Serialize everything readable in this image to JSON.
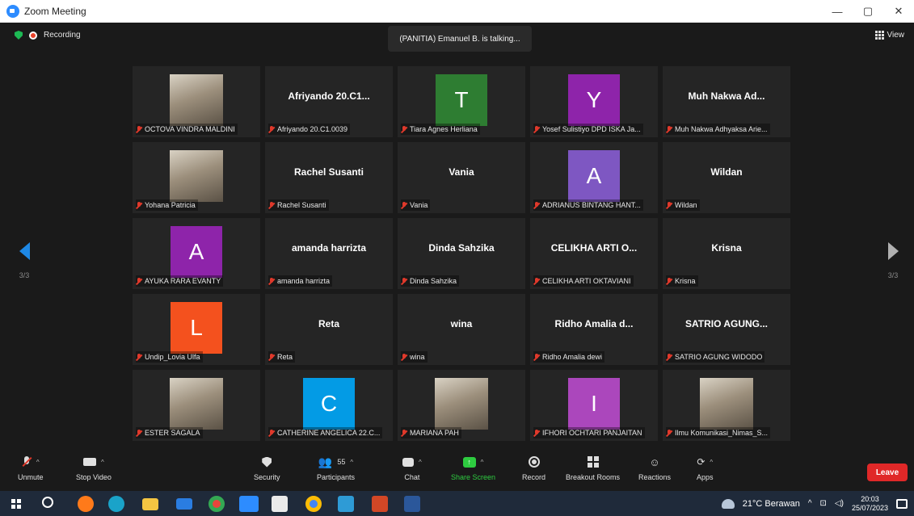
{
  "window": {
    "title": "Zoom Meeting",
    "min": "—",
    "max": "▢",
    "close": "✕"
  },
  "topbar": {
    "recording": "Recording",
    "talking": "(PANITIA) Emanuel B. is talking...",
    "view": "View"
  },
  "pager": {
    "left": "3/3",
    "right": "3/3"
  },
  "tiles": [
    {
      "big": "",
      "avatar": "",
      "photo": true,
      "label": "OCTOVA VINDRA MALDINI"
    },
    {
      "big": "Afriyando 20.C1...",
      "avatar": "",
      "label": "Afriyando 20.C1.0039"
    },
    {
      "big": "",
      "avatar": "T",
      "color": "#2e7d32",
      "label": "Tiara Agnes Herliana"
    },
    {
      "big": "",
      "avatar": "Y",
      "color": "#8e24aa",
      "label": "Yosef Sulistiyo DPD ISKA Ja..."
    },
    {
      "big": "Muh Nakwa Ad...",
      "avatar": "",
      "label": "Muh Nakwa Adhyaksa Arie..."
    },
    {
      "big": "",
      "avatar": "",
      "photo": true,
      "label": "Yohana Patricia"
    },
    {
      "big": "Rachel Susanti",
      "avatar": "",
      "label": "Rachel Susanti"
    },
    {
      "big": "Vania",
      "avatar": "",
      "label": "Vania"
    },
    {
      "big": "",
      "avatar": "A",
      "color": "#7e57c2",
      "label": "ADRIANUS BINTANG HANT..."
    },
    {
      "big": "Wildan",
      "avatar": "",
      "label": "Wildan"
    },
    {
      "big": "",
      "avatar": "A",
      "color": "#8e24aa",
      "label": "AYUKA RARA EVANTY"
    },
    {
      "big": "amanda harrizta",
      "avatar": "",
      "label": "amanda harrizta"
    },
    {
      "big": "Dinda Sahzika",
      "avatar": "",
      "label": "Dinda Sahzika"
    },
    {
      "big": "CELIKHA ARTI O...",
      "avatar": "",
      "label": "CELIKHA ARTI OKTAVIANI"
    },
    {
      "big": "Krisna",
      "avatar": "",
      "label": "Krisna"
    },
    {
      "big": "",
      "avatar": "L",
      "color": "#f4511e",
      "label": "Undip_Lovia Ulfa"
    },
    {
      "big": "Reta",
      "avatar": "",
      "label": "Reta"
    },
    {
      "big": "wina",
      "avatar": "",
      "label": "wina"
    },
    {
      "big": "Ridho Amalia d...",
      "avatar": "",
      "label": "Ridho Amalia dewi"
    },
    {
      "big": "SATRIO AGUNG...",
      "avatar": "",
      "label": "SATRIO AGUNG WIDODO"
    },
    {
      "big": "",
      "avatar": "",
      "photo": true,
      "label": "ESTER SAGALA"
    },
    {
      "big": "",
      "avatar": "C",
      "color": "#039be5",
      "label": "CATHERINE ANGELICA 22.C..."
    },
    {
      "big": "",
      "avatar": "",
      "photo": true,
      "label": "MARIANA PAH"
    },
    {
      "big": "",
      "avatar": "I",
      "color": "#ab47bc",
      "label": "IFHORI OCHTARI PANJAITAN"
    },
    {
      "big": "",
      "avatar": "",
      "photo": true,
      "label": "Ilmu Komunikasi_Nimas_S..."
    }
  ],
  "toolbar": {
    "unmute": "Unmute",
    "stop_video": "Stop Video",
    "security": "Security",
    "participants": "Participants",
    "participants_count": "55",
    "chat": "Chat",
    "share_screen": "Share Screen",
    "record": "Record",
    "breakout": "Breakout Rooms",
    "reactions": "Reactions",
    "apps": "Apps",
    "leave": "Leave"
  },
  "taskbar": {
    "weather": "21°C Berawan",
    "time": "20:03",
    "date": "25/07/2023"
  }
}
